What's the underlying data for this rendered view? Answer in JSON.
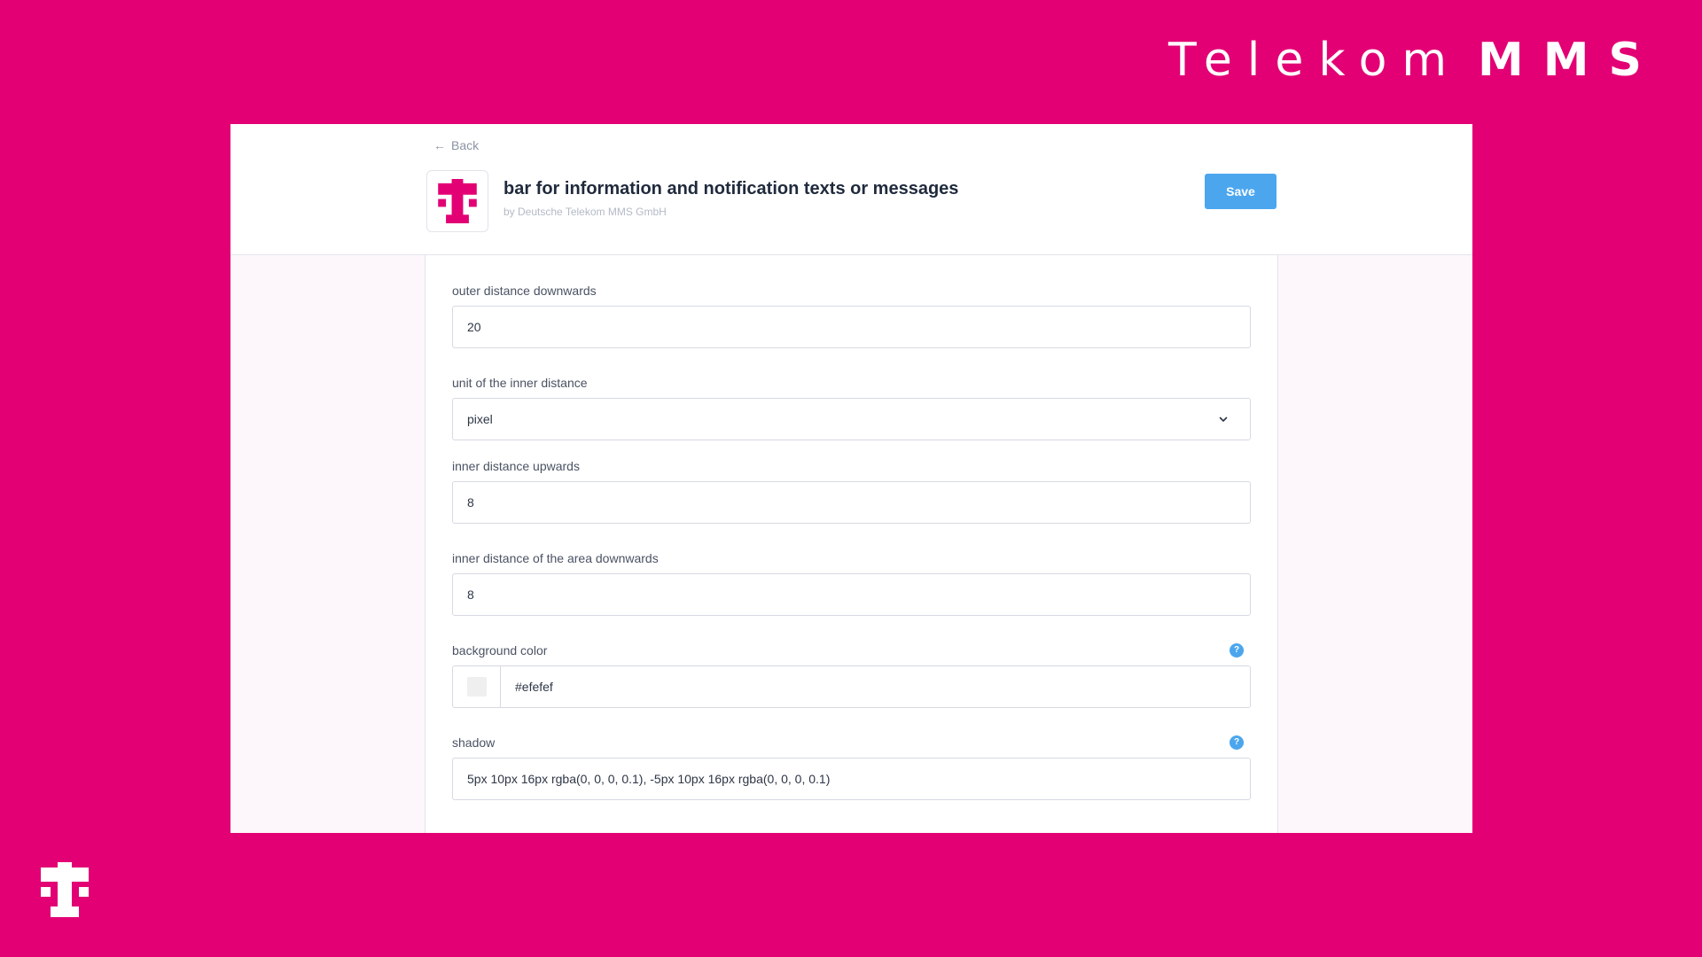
{
  "brand": {
    "part_a": "Telekom",
    "part_b": "MMS"
  },
  "header": {
    "back_label": "Back",
    "title": "bar for information and notification texts or messages",
    "author": "by Deutsche Telekom MMS GmbH",
    "save_label": "Save"
  },
  "form": {
    "outer_bottom": {
      "label": "outer distance downwards",
      "value": "20"
    },
    "inner_unit": {
      "label": "unit of the inner distance",
      "value": "pixel"
    },
    "inner_top": {
      "label": "inner distance upwards",
      "value": "8"
    },
    "inner_bottom": {
      "label": "inner distance of the area downwards",
      "value": "8"
    },
    "background_color": {
      "label": "background color",
      "value": "#efefef",
      "help": "?"
    },
    "shadow": {
      "label": "shadow",
      "value": "5px 10px 16px rgba(0, 0, 0, 0.1), -5px 10px 16px rgba(0, 0, 0, 0.1)",
      "help": "?"
    }
  },
  "colors": {
    "brand_magenta": "#e20074",
    "accent_blue": "#4ba6ee",
    "swatch": "#efefef"
  },
  "icons": {
    "back": "arrow-left-icon",
    "dropdown": "chevron-down-icon",
    "help": "question-mark-icon",
    "logo": "telekom-t-logo"
  }
}
